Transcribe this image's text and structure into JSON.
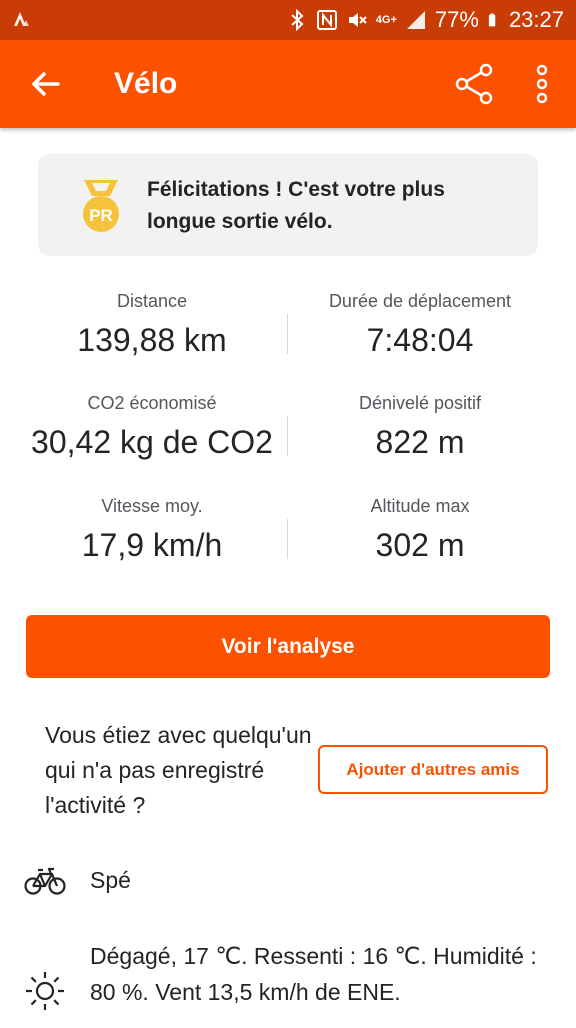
{
  "status_bar": {
    "network_label": "4G+",
    "battery": "77%",
    "time": "23:27"
  },
  "app_bar": {
    "title": "Vélo"
  },
  "pr_banner": {
    "badge_text": "PR",
    "message": "Félicitations ! C'est votre plus longue sortie vélo."
  },
  "stats": [
    {
      "label": "Distance",
      "value": "139,88 km"
    },
    {
      "label": "Durée de déplacement",
      "value": "7:48:04"
    },
    {
      "label": "CO2 économisé",
      "value": "30,42 kg de CO2"
    },
    {
      "label": "Dénivelé positif",
      "value": "822 m"
    },
    {
      "label": "Vitesse moy.",
      "value": "17,9 km/h"
    },
    {
      "label": "Altitude max",
      "value": "302 m"
    }
  ],
  "analysis_button": "Voir l'analyse",
  "tag_friends": {
    "prompt": "Vous étiez avec quelqu'un qui n'a pas enregistré l'activité ?",
    "button": "Ajouter d'autres amis"
  },
  "gear": {
    "icon": "bike-icon",
    "name": "Spé"
  },
  "weather": {
    "icon": "sun-icon",
    "text": "Dégagé, 17 ℃. Ressenti : 16 ℃. Humidité : 80 %. Vent 13,5 km/h de ENE."
  },
  "colors": {
    "brand": "#fc5200",
    "status_bar": "#c93c06",
    "medal": "#f5c33b"
  }
}
